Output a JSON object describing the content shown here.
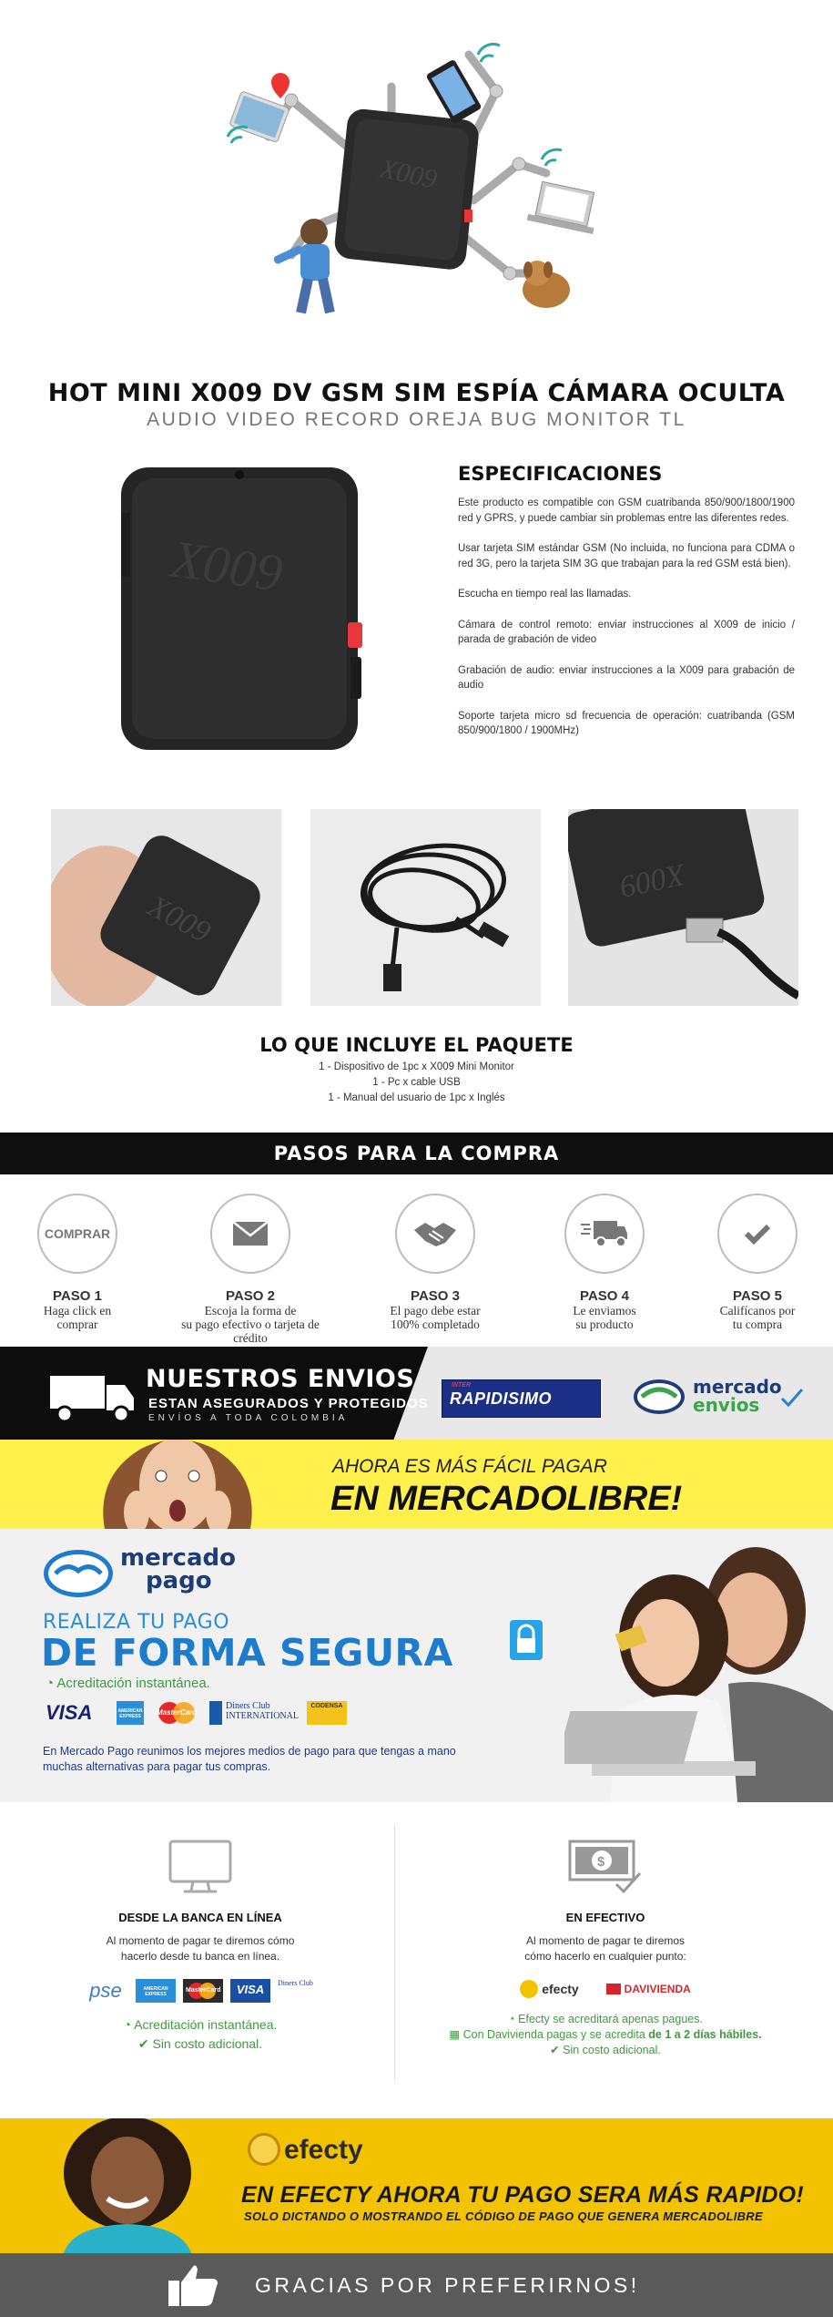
{
  "product": {
    "title": "HOT MINI X009 DV GSM SIM ESPÍA CÁMARA OCULTA",
    "subtitle": "AUDIO VIDEO RECORD OREJA BUG MONITOR TL",
    "device_label": "X009"
  },
  "specs": {
    "heading": "ESPECIFICACIONES",
    "paragraphs": [
      "Este producto es compatible con GSM cuatribanda 850/900/1800/1900 red y GPRS, y puede cambiar sin problemas entre las diferentes redes.",
      "Usar tarjeta SIM estándar GSM (No incluida, no funciona para CDMA o red 3G, pero la tarjeta SIM 3G que trabajan para la red GSM está bien).",
      "Escucha en tiempo real las llamadas.",
      "Cámara de control remoto: enviar instrucciones al X009 de inicio / parada de grabación de video",
      "Grabación de audio: enviar instrucciones a la X009 para grabación de audio",
      "Soporte tarjeta micro sd frecuencia de operación: cuatribanda (GSM 850/900/1800 / 1900MHz)"
    ]
  },
  "package": {
    "heading": "LO QUE INCLUYE EL PAQUETE",
    "items": [
      "1 - Dispositivo de 1pc x X009 Mini Monitor",
      "1 - Pc x cable USB",
      "1 - Manual del usuario de 1pc x Inglés"
    ]
  },
  "steps": {
    "heading": "PASOS PARA LA COMPRA",
    "items": [
      {
        "icon": "comprar-text-icon",
        "icon_text": "COMPRAR",
        "num": "PASO 1",
        "line1": "Haga click en",
        "line2": "comprar"
      },
      {
        "icon": "envelope-icon",
        "num": "PASO 2",
        "line1": "Escoja la forma de",
        "line2": "su pago efectivo o tarjeta de crédito"
      },
      {
        "icon": "handshake-icon",
        "num": "PASO 3",
        "line1": "El pago debe estar",
        "line2": "100% completado"
      },
      {
        "icon": "truck-icon",
        "num": "PASO 4",
        "line1": "Le enviamos",
        "line2": "su producto"
      },
      {
        "icon": "checkmark-icon",
        "num": "PASO 5",
        "line1": "Califícanos por",
        "line2": "tu compra"
      }
    ]
  },
  "shipping": {
    "title": "NUESTROS ENVIOS",
    "subtitle": "ESTAN ASEGURADOS Y PROTEGIDOS",
    "tagline": "ENVÍOS A TODA COLOMBIA",
    "carrier1_small": "INTER",
    "carrier1": "RAPIDISIMO",
    "carrier2_line1": "mercado",
    "carrier2_line2": "envios"
  },
  "banner_ml": {
    "line1": "AHORA ES MÁS FÁCIL PAGAR",
    "line2": "EN MERCADOLIBRE!"
  },
  "mercadopago": {
    "logo_line1": "mercado",
    "logo_line2": "pago",
    "headline1": "REALIZA TU PAGO",
    "headline2": "DE FORMA SEGURA",
    "accreditation": "Acreditación instantánea.",
    "cards": [
      "VISA",
      "AMERICAN EXPRESS",
      "MasterCard",
      "Diners Club INTERNATIONAL",
      "CODENSA"
    ],
    "paragraph": "En Mercado Pago reunimos los mejores medios de pago para que tengas a mano muchas alternativas para pagar tus compras."
  },
  "bank": {
    "heading": "DESDE LA BANCA EN LÍNEA",
    "text1": "Al momento de pagar te diremos cómo",
    "text2": "hacerlo desde tu banca en línea.",
    "logos": [
      "pse",
      "AMERICAN EXPRESS",
      "MasterCard",
      "VISA",
      "Diners Club"
    ],
    "note1": "Acreditación instantánea.",
    "note2": "Sin costo adicional."
  },
  "cash": {
    "heading": "EN EFECTIVO",
    "text1": "Al momento de pagar te diremos",
    "text2": "cómo hacerlo en cualquier punto:",
    "logo1": "efecty",
    "logo2": "DAVIVIENDA",
    "note1": "Efecty se acreditará apenas pagues.",
    "note2a": "Con Davivienda pagas y se acredita",
    "note2b": "de 1 a 2 días hábiles.",
    "note3": "Sin costo adicional."
  },
  "efecty_banner": {
    "brand": "efecty",
    "line1": "EN EFECTY AHORA TU PAGO SERA MÁS RAPIDO!",
    "line2": "SOLO DICTANDO O MOSTRANDO EL CÓDIGO DE PAGO QUE GENERA MERCADOLIBRE"
  },
  "footer": {
    "thanks": "GRACIAS POR PREFERIRNOS!"
  },
  "colors": {
    "mp_blue": "#1e7ccd",
    "yellow": "#fff04c",
    "efecty_yellow": "#f3c200",
    "green": "#3e9a3e"
  }
}
